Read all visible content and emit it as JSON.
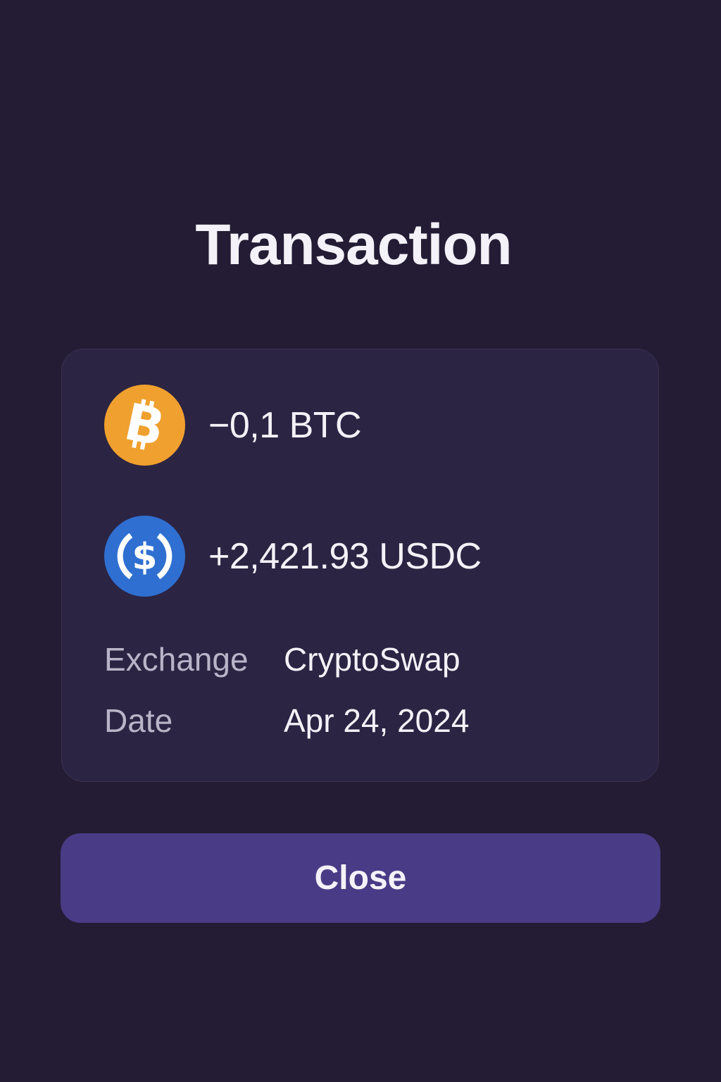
{
  "header": {
    "title": "Transaction"
  },
  "transaction": {
    "sent": {
      "icon": "bitcoin-icon",
      "amount": "−0,1 BTC",
      "color": "#f0a02e"
    },
    "received": {
      "icon": "usdc-icon",
      "amount": "+2,421.93 USDC",
      "color": "#2f6fd1"
    },
    "details": [
      {
        "label": "Exchange",
        "value": "CryptoSwap"
      },
      {
        "label": "Date",
        "value": "Apr 24, 2024"
      }
    ]
  },
  "actions": {
    "close_label": "Close"
  },
  "colors": {
    "background": "#241c34",
    "card": "#2c2443",
    "button": "#4a3b86"
  }
}
